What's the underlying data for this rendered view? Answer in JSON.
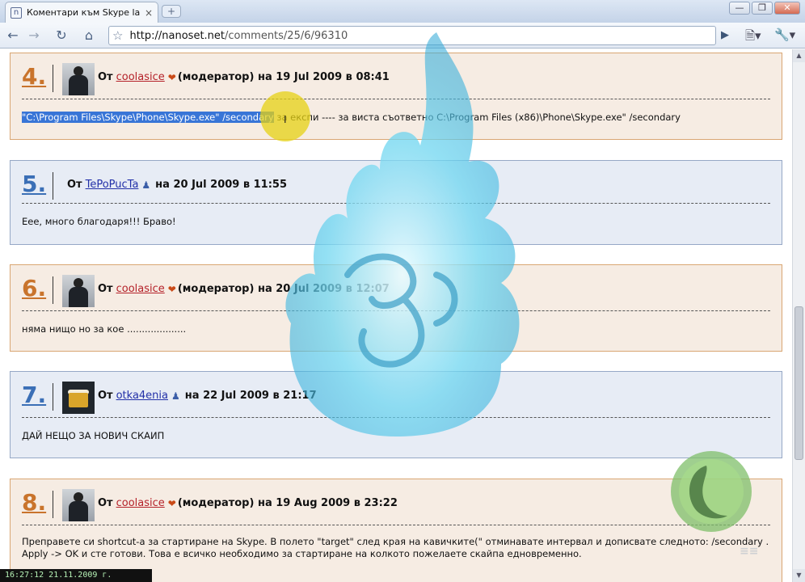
{
  "browser": {
    "tab_title": "Коментари към Skype lau...",
    "tab_close": "×",
    "new_tab": "+",
    "url_host": "http://nanoset.net",
    "url_path": "/comments/25/6/96310",
    "window_buttons": [
      "—",
      "❐",
      "✕"
    ]
  },
  "comments": [
    {
      "number": "4.",
      "prefix": "От",
      "author": "coolasice",
      "role": "(модератор)",
      "on": "на",
      "date": "19 Jul 2009",
      "at": "в",
      "time": "08:41",
      "text_selected": "\"C:\\Program Files\\Skype\\Phone\\Skype.exe\" /secondary",
      "text_rest": " за експи ---- за виста съответно C:\\Program Files (x86)\\Phone\\Skype.exe\" /secondary",
      "color": "orange",
      "avatar": "ninja"
    },
    {
      "number": "5.",
      "prefix": "От",
      "author": "TePoPucTa",
      "role": "",
      "on": "на",
      "date": "20 Jul 2009",
      "at": "в",
      "time": "11:55",
      "text": "Еее, много благодаря!!! Браво!",
      "color": "blue",
      "avatar": "none"
    },
    {
      "number": "6.",
      "prefix": "От",
      "author": "coolasice",
      "role": "(модератор)",
      "on": "на",
      "date": "20 Jul 2009",
      "at": "в",
      "time": "12:07",
      "text": "няма нищо но за кое ....................",
      "color": "orange",
      "avatar": "ninja"
    },
    {
      "number": "7.",
      "prefix": "От",
      "author": "otka4enia",
      "role": "",
      "on": "на",
      "date": "22 Jul 2009",
      "at": "в",
      "time": "21:17",
      "text": "ДАЙ НЕЩО ЗА НОВИЧ СКАИП",
      "color": "blue",
      "avatar": "beer"
    },
    {
      "number": "8.",
      "prefix": "От",
      "author": "coolasice",
      "role": "(модератор)",
      "on": "на",
      "date": "19 Aug 2009",
      "at": "в",
      "time": "23:22",
      "text": "Преправете си shortcut-a за стартиране на Skype. В полето \"target\" след края на кавичките(\" отминавате интервал и дописвате следното: /secondary . Apply -> OK и сте готови. Това е всичко необходимо за стартиране на колкото пожелаете скайпа едновременно.",
      "color": "orange",
      "avatar": "ninja"
    }
  ],
  "overlay": {
    "clock": "16:27:12 21.11.2009 г.",
    "halo_color": "#e6d214",
    "flame_color": "#6fd6f0"
  }
}
